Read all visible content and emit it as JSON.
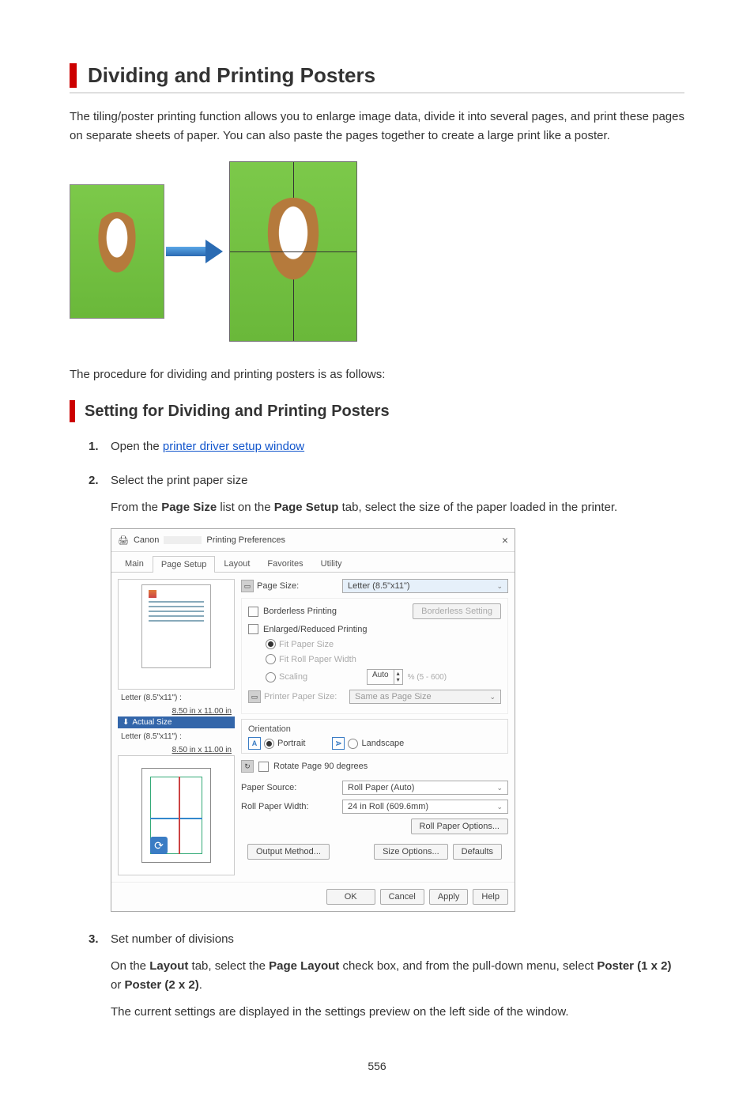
{
  "page_title": "Dividing and Printing Posters",
  "intro": "The tiling/poster printing function allows you to enlarge image data, divide it into several pages, and print these pages on separate sheets of paper. You can also paste the pages together to create a large print like a poster.",
  "procedure_line": "The procedure for dividing and printing posters is as follows:",
  "section_heading": "Setting for Dividing and Printing Posters",
  "steps": {
    "s1": {
      "num": "1.",
      "prefix": "Open the ",
      "link": "printer driver setup window"
    },
    "s2": {
      "num": "2.",
      "title": "Select the print paper size",
      "desc_prefix": "From the ",
      "desc_b1": "Page Size",
      "desc_mid1": " list on the ",
      "desc_b2": "Page Setup",
      "desc_suffix": " tab, select the size of the paper loaded in the printer."
    },
    "s3": {
      "num": "3.",
      "title": "Set number of divisions",
      "p1_prefix": "On the ",
      "p1_b1": "Layout",
      "p1_mid1": " tab, select the ",
      "p1_b2": "Page Layout",
      "p1_mid2": " check box, and from the pull-down menu, select ",
      "p1_b3": "Poster (1 x 2)",
      "p1_mid3": " or ",
      "p1_b4": "Poster (2 x 2)",
      "p1_suffix": ".",
      "p2": "The current settings are displayed in the settings preview on the left side of the window."
    }
  },
  "dialog": {
    "title_prefix": "Canon",
    "title_suffix": "Printing Preferences",
    "tabs": [
      "Main",
      "Page Setup",
      "Layout",
      "Favorites",
      "Utility"
    ],
    "active_tab": "Page Setup",
    "page_size_label": "Page Size:",
    "page_size_value": "Letter (8.5\"x11\")",
    "borderless": "Borderless Printing",
    "borderless_btn": "Borderless Setting",
    "enlarged": "Enlarged/Reduced Printing",
    "fit_paper": "Fit Paper Size",
    "fit_roll": "Fit Roll Paper Width",
    "scaling": "Scaling",
    "scaling_value": "Auto",
    "scaling_range": "%  (5 - 600)",
    "printer_paper_label": "Printer Paper Size:",
    "printer_paper_value": "Same as Page Size",
    "left_size1_a": "Letter (8.5\"x11\") :",
    "left_size1_b": "8.50 in x 11.00 in",
    "actual_size": "Actual Size",
    "left_size2_a": "Letter (8.5\"x11\") :",
    "left_size2_b": "8.50 in x 11.00 in",
    "orientation": "Orientation",
    "portrait": "Portrait",
    "landscape": "Landscape",
    "rotate": "Rotate Page 90 degrees",
    "paper_source_label": "Paper Source:",
    "paper_source_value": "Roll Paper (Auto)",
    "roll_width_label": "Roll Paper Width:",
    "roll_width_value": "24 in Roll (609.6mm)",
    "roll_options_btn": "Roll Paper Options...",
    "output_method": "Output Method...",
    "size_options": "Size Options...",
    "defaults": "Defaults",
    "ok": "OK",
    "cancel": "Cancel",
    "apply": "Apply",
    "help": "Help"
  },
  "page_number": "556"
}
